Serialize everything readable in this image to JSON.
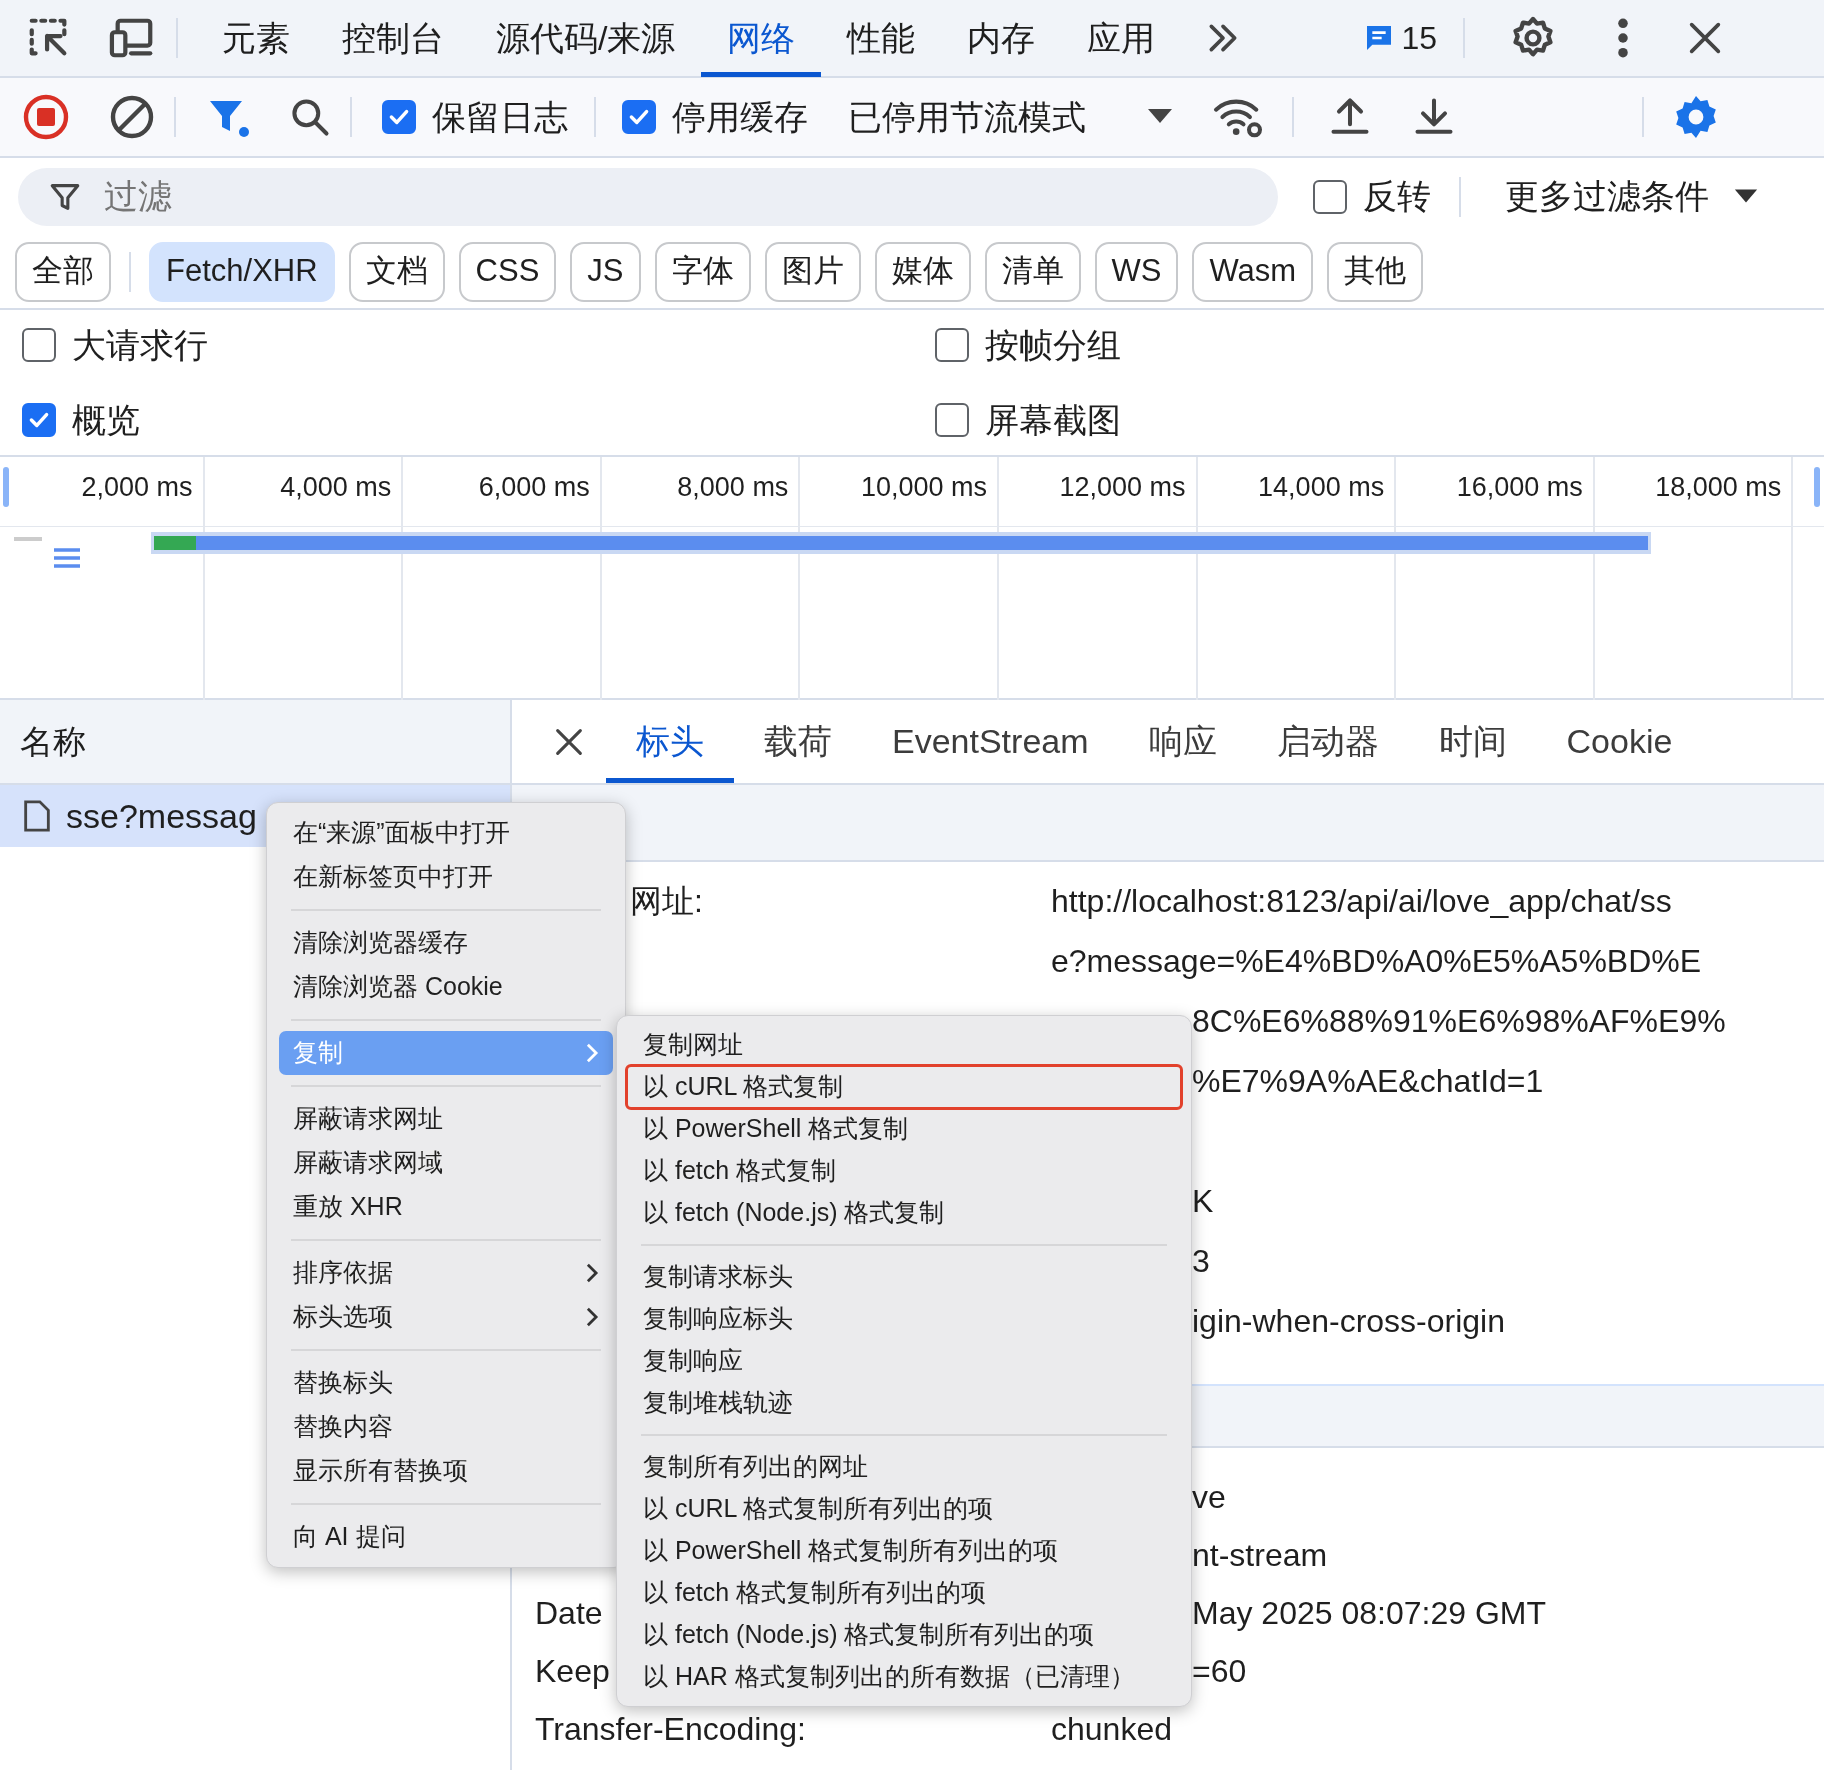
{
  "top_tabs": [
    {
      "label": "元素",
      "selected": false
    },
    {
      "label": "控制台",
      "selected": false
    },
    {
      "label": "源代码/来源",
      "selected": false
    },
    {
      "label": "网络",
      "selected": true
    },
    {
      "label": "性能",
      "selected": false
    },
    {
      "label": "内存",
      "selected": false
    },
    {
      "label": "应用",
      "selected": false
    }
  ],
  "issues": {
    "count": "15"
  },
  "toolbar": {
    "checkboxes": [
      {
        "label": "保留日志",
        "checked": true
      },
      {
        "label": "停用缓存",
        "checked": true
      }
    ],
    "throttling": "已停用节流模式"
  },
  "filter": {
    "placeholder": "过滤",
    "invert": {
      "label": "反转",
      "checked": false
    },
    "more_filters": "更多过滤条件"
  },
  "type_chips": [
    {
      "label": "全部",
      "selected": false
    },
    {
      "label": "Fetch/XHR",
      "selected": true
    },
    {
      "label": "文档",
      "selected": false
    },
    {
      "label": "CSS",
      "selected": false
    },
    {
      "label": "JS",
      "selected": false
    },
    {
      "label": "字体",
      "selected": false
    },
    {
      "label": "图片",
      "selected": false
    },
    {
      "label": "媒体",
      "selected": false
    },
    {
      "label": "清单",
      "selected": false
    },
    {
      "label": "WS",
      "selected": false
    },
    {
      "label": "Wasm",
      "selected": false
    },
    {
      "label": "其他",
      "selected": false
    }
  ],
  "options": [
    {
      "label": "大请求行",
      "checked": false
    },
    {
      "label": "按帧分组",
      "checked": false
    },
    {
      "label": "概览",
      "checked": true
    },
    {
      "label": "屏幕截图",
      "checked": false
    }
  ],
  "timeline": {
    "ticks": [
      "2,000 ms",
      "4,000 ms",
      "6,000 ms",
      "8,000 ms",
      "10,000 ms",
      "12,000 ms",
      "14,000 ms",
      "16,000 ms",
      "18,000 ms"
    ]
  },
  "requests": {
    "column": "名称",
    "rows": [
      {
        "name": "sse?messag",
        "selected": true
      }
    ]
  },
  "detail_tabs": [
    {
      "label": "标头",
      "selected": true
    },
    {
      "label": "载荷",
      "selected": false
    },
    {
      "label": "EventStream",
      "selected": false
    },
    {
      "label": "响应",
      "selected": false
    },
    {
      "label": "启动器",
      "selected": false
    },
    {
      "label": "时间",
      "selected": false
    },
    {
      "label": "Cookie",
      "selected": false
    }
  ],
  "general": {
    "url_label": "网址:",
    "url_lines": [
      {
        "text": "http://localhost:8123/api/ai/love_app/chat/ss",
        "kind": "full"
      },
      {
        "text": "e?message=%E4%BD%A0%E5%A5%BD%E",
        "kind": "full"
      },
      {
        "text": "8C%E6%88%91%E6%98%AF%E9%",
        "kind": "partial"
      },
      {
        "text": "%E7%9A%AE&chatId=1",
        "kind": "partial"
      }
    ],
    "rows": [
      {
        "value": "K",
        "kind": "partial"
      },
      {
        "value": "3",
        "kind": "partial"
      },
      {
        "value": "igin-when-cross-origin",
        "kind": "partial"
      }
    ]
  },
  "response_headers": {
    "rows": [
      {
        "label": "",
        "value": "ve",
        "kind": "partial"
      },
      {
        "label": "",
        "value": "nt-stream",
        "kind": "partial"
      },
      {
        "label": "Date",
        "value": "May 2025 08:07:29 GMT",
        "kind": "partial"
      },
      {
        "label": "Keep",
        "value": "=60",
        "kind": "partial"
      },
      {
        "label": "Transfer-Encoding:",
        "value": "chunked",
        "kind": "full"
      }
    ]
  },
  "context_menu": {
    "items": [
      {
        "kind": "item",
        "label": "在“来源”面板中打开",
        "submenu": false,
        "selected": false
      },
      {
        "kind": "item",
        "label": "在新标签页中打开",
        "submenu": false,
        "selected": false
      },
      {
        "kind": "separator"
      },
      {
        "kind": "item",
        "label": "清除浏览器缓存",
        "submenu": false,
        "selected": false
      },
      {
        "kind": "item",
        "label": "清除浏览器 Cookie",
        "submenu": false,
        "selected": false
      },
      {
        "kind": "separator"
      },
      {
        "kind": "item",
        "label": "复制",
        "submenu": true,
        "selected": true
      },
      {
        "kind": "separator"
      },
      {
        "kind": "item",
        "label": "屏蔽请求网址",
        "submenu": false,
        "selected": false
      },
      {
        "kind": "item",
        "label": "屏蔽请求网域",
        "submenu": false,
        "selected": false
      },
      {
        "kind": "item",
        "label": "重放 XHR",
        "submenu": false,
        "selected": false
      },
      {
        "kind": "separator"
      },
      {
        "kind": "item",
        "label": "排序依据",
        "submenu": true,
        "selected": false
      },
      {
        "kind": "item",
        "label": "标头选项",
        "submenu": true,
        "selected": false
      },
      {
        "kind": "separator"
      },
      {
        "kind": "item",
        "label": "替换标头",
        "submenu": false,
        "selected": false
      },
      {
        "kind": "item",
        "label": "替换内容",
        "submenu": false,
        "selected": false
      },
      {
        "kind": "item",
        "label": "显示所有替换项",
        "submenu": false,
        "selected": false
      },
      {
        "kind": "separator"
      },
      {
        "kind": "item",
        "label": "向 AI 提问",
        "submenu": false,
        "selected": false
      }
    ]
  },
  "copy_submenu": {
    "items": [
      {
        "kind": "item",
        "label": "复制网址",
        "outlined": false
      },
      {
        "kind": "item",
        "label": "以 cURL 格式复制",
        "outlined": true
      },
      {
        "kind": "item",
        "label": "以 PowerShell 格式复制",
        "outlined": false
      },
      {
        "kind": "item",
        "label": "以 fetch 格式复制",
        "outlined": false
      },
      {
        "kind": "item",
        "label": "以 fetch (Node.js) 格式复制",
        "outlined": false
      },
      {
        "kind": "separator"
      },
      {
        "kind": "item",
        "label": "复制请求标头",
        "outlined": false
      },
      {
        "kind": "item",
        "label": "复制响应标头",
        "outlined": false
      },
      {
        "kind": "item",
        "label": "复制响应",
        "outlined": false
      },
      {
        "kind": "item",
        "label": "复制堆栈轨迹",
        "outlined": false
      },
      {
        "kind": "separator"
      },
      {
        "kind": "item",
        "label": "复制所有列出的网址",
        "outlined": false
      },
      {
        "kind": "item",
        "label": "以 cURL 格式复制所有列出的项",
        "outlined": false
      },
      {
        "kind": "item",
        "label": "以 PowerShell 格式复制所有列出的项",
        "outlined": false
      },
      {
        "kind": "item",
        "label": "以 fetch 格式复制所有列出的项",
        "outlined": false
      },
      {
        "kind": "item",
        "label": "以 fetch (Node.js) 格式复制所有列出的项",
        "outlined": false
      },
      {
        "kind": "item",
        "label": "以 HAR 格式复制列出的所有数据（已清理）",
        "outlined": false
      }
    ]
  }
}
